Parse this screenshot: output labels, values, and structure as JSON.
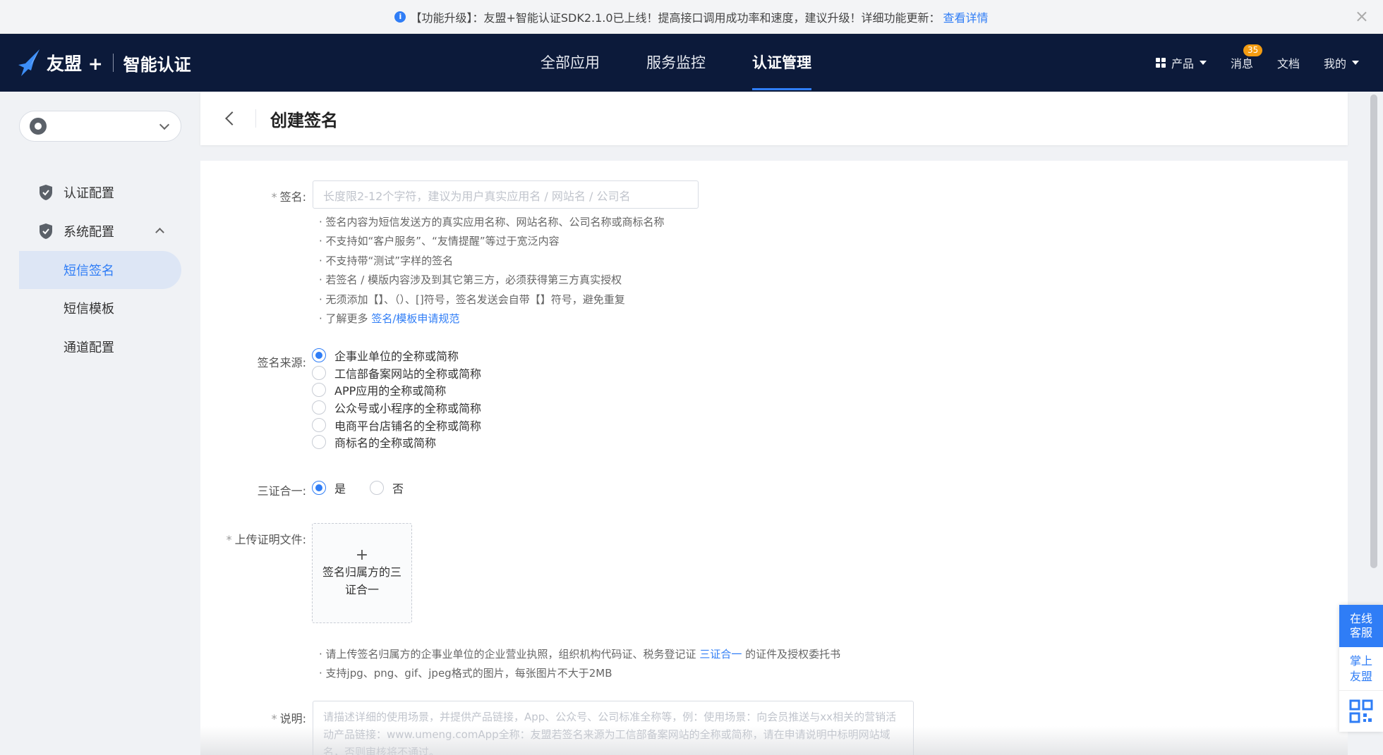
{
  "notice": {
    "icon": "info-icon",
    "text": "【功能升级】：友盟+智能认证SDK2.1.0已上线！提高接口调用成功率和速度，建议升级！详细功能更新：",
    "link": "查看详情",
    "close_icon": "close-icon"
  },
  "topnav": {
    "brand": "友盟 +",
    "product": "智能认证",
    "menu": [
      "全部应用",
      "服务监控",
      "认证管理"
    ],
    "active_menu": "认证管理",
    "right": {
      "products": "产品",
      "messages": "消息",
      "messages_badge": "35",
      "docs": "文档",
      "mine": "我的"
    }
  },
  "sidebar": {
    "app_select_icon": "apple-icon",
    "items": [
      {
        "label": "认证配置"
      },
      {
        "label": "系统配置"
      },
      {
        "label": "短信签名"
      },
      {
        "label": "短信模板"
      },
      {
        "label": "通道配置"
      }
    ],
    "active": "短信签名"
  },
  "page": {
    "title": "创建签名"
  },
  "form": {
    "signature": {
      "label": "签名:",
      "required": true,
      "placeholder": "长度限2-12个字符，建议为用户真实应用名 / 网站名 / 公司名",
      "hints": [
        "· 签名内容为短信发送方的真实应用名称、网站名称、公司名称或商标名称",
        "· 不支持如“客户服务”、“友情提醒”等过于宽泛内容",
        "· 不支持带“测试”字样的签名",
        "· 若签名 / 模版内容涉及到其它第三方，必须获得第三方真实授权",
        "· 无须添加【】、（）、[]符号，签名发送会自带【】符号，避免重复"
      ],
      "more_prefix": "· 了解更多 ",
      "more_link": "签名/模板申请规范"
    },
    "source": {
      "label": "签名来源:",
      "options": [
        "企事业单位的全称或简称",
        "工信部备案网站的全称或简称",
        "APP应用的全称或简称",
        "公众号或小程序的全称或简称",
        "电商平台店铺名的全称或简称",
        "商标名的全称或简称"
      ],
      "selected_index": 0
    },
    "three_in_one": {
      "label": "三证合一:",
      "yes": "是",
      "no": "否",
      "selected": "是"
    },
    "upload": {
      "label": "上传证明文件:",
      "required": true,
      "plus": "+",
      "button_line1": "签名归属方的三",
      "button_line2": "证合一",
      "hint1_prefix": "· 请上传签名归属方的企事业单位的企业营业执照，组织机构代码证、税务登记证 ",
      "hint1_link": "三证合一",
      "hint1_suffix": " 的证件及授权委托书",
      "hint2": "· 支持jpg、png、gif、jpeg格式的图片，每张图片不大于2MB"
    },
    "description": {
      "label": "说明:",
      "required": true,
      "placeholder": "请描述详细的使用场景，并提供产品链接，App、公众号、公司标准全称等，例：使用场景：向会员推送与xx相关的营销活动产品链接：www.umeng.comApp全称：友盟若签名来源为工信部备案网站的全称或简称，请在申请说明中标明网站域名，否则审核将不通过。"
    }
  },
  "float_widget": {
    "online_service": [
      "在线",
      "客服"
    ],
    "mobile": [
      "掌上",
      "友盟"
    ],
    "qr_icon": "qrcode-icon"
  },
  "colors": {
    "accent": "#2f7df6",
    "topnav_bg": "#0c1a3a",
    "badge": "#f39c12"
  }
}
